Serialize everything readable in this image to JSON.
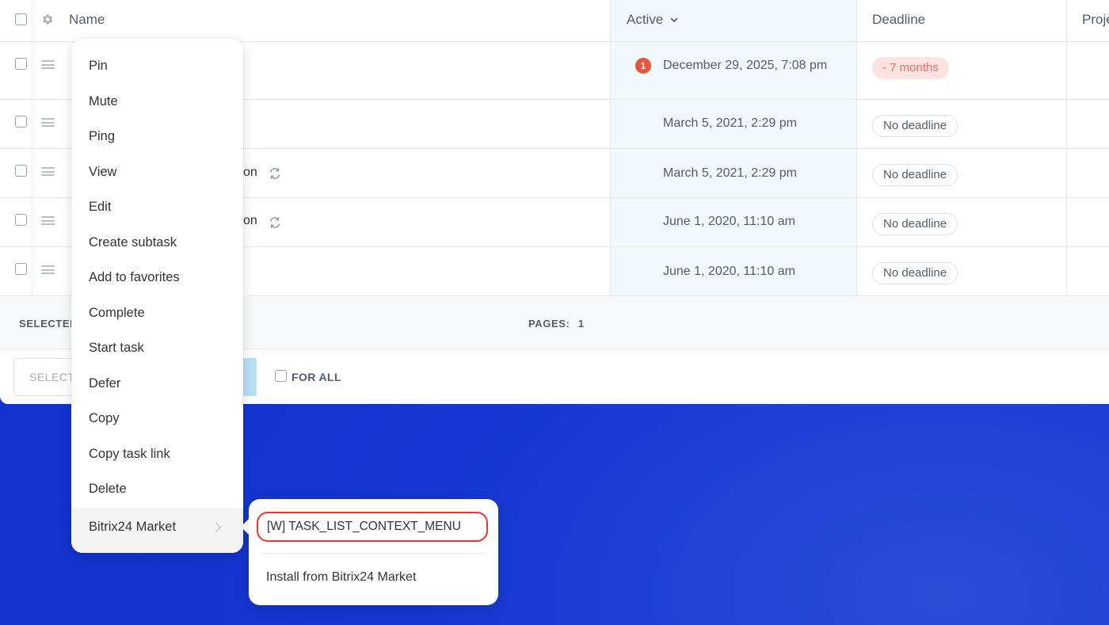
{
  "table": {
    "columns": {
      "name": "Name",
      "active": "Active",
      "deadline": "Deadline",
      "project": "Proje"
    },
    "rows": [
      {
        "name_fragment": "",
        "active": "December 29, 2025, 7:08 pm",
        "active_counter": "1",
        "deadline": "- 7 months",
        "deadline_type": "overdue"
      },
      {
        "name_fragment": "",
        "active": "March 5, 2021, 2:29 pm",
        "deadline": "No deadline",
        "deadline_type": "none"
      },
      {
        "name_fragment": "on",
        "active": "March 5, 2021, 2:29 pm",
        "deadline": "No deadline",
        "deadline_type": "none",
        "recurring": true
      },
      {
        "name_fragment": "on",
        "active": "June 1, 2020, 11:10 am",
        "deadline": "No deadline",
        "deadline_type": "none",
        "recurring": true
      },
      {
        "name_fragment": "",
        "active": "June 1, 2020, 11:10 am",
        "deadline": "No deadline",
        "deadline_type": "none"
      }
    ]
  },
  "footer": {
    "selected_label": "SELECTED",
    "pages_label": "PAGES:",
    "pages_value": "1",
    "action_select_placeholder": "SELECT",
    "for_all_label": "FOR ALL"
  },
  "context_menu": {
    "items": [
      "Pin",
      "Mute",
      "Ping",
      "View",
      "Edit",
      "Create subtask",
      "Add to favorites",
      "Complete",
      "Start task",
      "Defer",
      "Copy",
      "Copy task link",
      "Delete",
      "Bitrix24 Market"
    ],
    "submenu": {
      "items": [
        "[W] TASK_LIST_CONTEXT_MENU",
        "Install from Bitrix24 Market"
      ]
    }
  },
  "colors": {
    "background_blue": "#1536d2",
    "overdue_badge": "#e8543c",
    "highlight_outline": "#e8352e",
    "active_column_bg": "#f2f9fd"
  }
}
